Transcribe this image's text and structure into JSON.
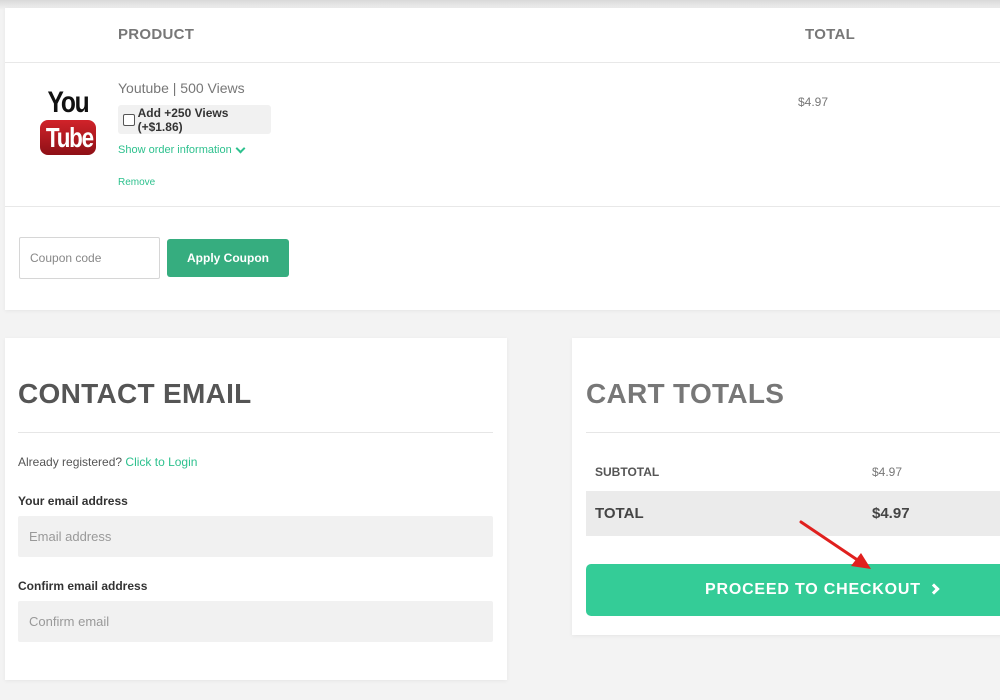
{
  "cart": {
    "header": {
      "product": "PRODUCT",
      "total": "TOTAL"
    },
    "item": {
      "logo_text_top": "You",
      "logo_text_bottom": "Tube",
      "name": "Youtube | 500 Views",
      "addon_label": "Add +250 Views (+$1.86)",
      "addon_checked": false,
      "show_info": "Show order information",
      "remove": "Remove",
      "price": "$4.97"
    },
    "coupon": {
      "placeholder": "Coupon code",
      "value": "",
      "apply_label": "Apply Coupon"
    }
  },
  "contact": {
    "title": "CONTACT EMAIL",
    "already_text": "Already registered?",
    "login_link": "Click to Login",
    "email_label": "Your email address",
    "email_placeholder": "Email address",
    "confirm_label": "Confirm email address",
    "confirm_placeholder": "Confirm email"
  },
  "totals": {
    "title": "CART TOTALS",
    "subtotal_label": "SUBTOTAL",
    "subtotal_value": "$4.97",
    "total_label": "TOTAL",
    "total_value": "$4.97",
    "checkout_label": "PROCEED TO CHECKOUT"
  },
  "colors": {
    "accent_green": "#34cc97",
    "apply_button": "#36ad7f",
    "link_green": "#2ec18e",
    "annotation_red": "#e0201e"
  },
  "icons": {
    "addon_checkbox": "checkbox-icon",
    "show_info": "chevron-down-icon",
    "checkout": "chevron-right-icon",
    "annotation": "red-arrow-icon"
  }
}
